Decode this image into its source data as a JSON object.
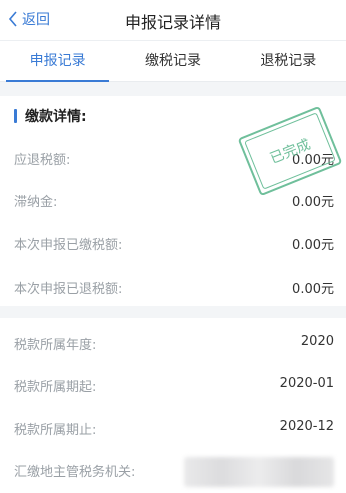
{
  "nav": {
    "back_label": "返回",
    "title": "申报记录详情"
  },
  "tabs": [
    {
      "label": "申报记录",
      "active": true
    },
    {
      "label": "缴税记录",
      "active": false
    },
    {
      "label": "退税记录",
      "active": false
    }
  ],
  "payment": {
    "section_title": "缴款详情:",
    "stamp_text": "已完成",
    "rows": [
      {
        "label": "应退税额:",
        "value": "0.00元"
      },
      {
        "label": "滞纳金:",
        "value": "0.00元"
      },
      {
        "label": "本次申报已缴税额:",
        "value": "0.00元"
      },
      {
        "label": "本次申报已退税额:",
        "value": "0.00元"
      }
    ]
  },
  "tax_info": {
    "rows": [
      {
        "label": "税款所属年度:",
        "value": "2020"
      },
      {
        "label": "税款所属期起:",
        "value": "2020-01"
      },
      {
        "label": "税款所属期止:",
        "value": "2020-12"
      },
      {
        "label": "汇缴地主管税务机关:",
        "value": ""
      }
    ]
  },
  "colors": {
    "accent": "#3a7bd5",
    "stamp": "#57b58a",
    "background": "#f3f5f7"
  }
}
